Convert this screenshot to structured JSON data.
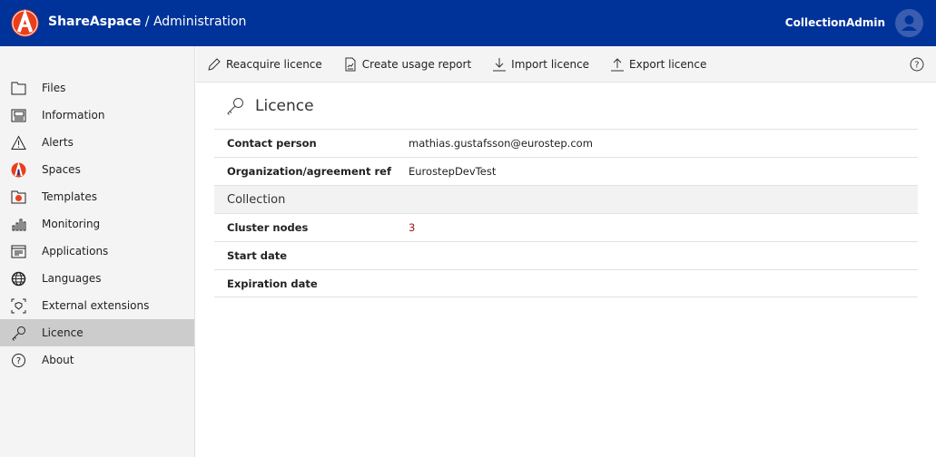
{
  "header": {
    "brand": "ShareAspace",
    "section": " / Administration",
    "user": "CollectionAdmin"
  },
  "sidebar": {
    "items": [
      {
        "label": "Files",
        "icon": "folder-icon"
      },
      {
        "label": "Information",
        "icon": "newspaper-icon"
      },
      {
        "label": "Alerts",
        "icon": "warning-icon"
      },
      {
        "label": "Spaces",
        "icon": "shareaspace-logo-icon"
      },
      {
        "label": "Templates",
        "icon": "template-folder-icon"
      },
      {
        "label": "Monitoring",
        "icon": "bar-chart-icon"
      },
      {
        "label": "Applications",
        "icon": "app-window-icon"
      },
      {
        "label": "Languages",
        "icon": "globe-icon"
      },
      {
        "label": "External extensions",
        "icon": "extension-scan-icon"
      },
      {
        "label": "Licence",
        "icon": "key-icon",
        "active": true
      },
      {
        "label": "About",
        "icon": "question-icon"
      }
    ]
  },
  "toolbar": {
    "reacquire": "Reacquire licence",
    "report": "Create usage report",
    "import": "Import licence",
    "export": "Export licence"
  },
  "page": {
    "title": "Licence",
    "contact_label": "Contact person",
    "contact_value": "mathias.gustafsson@eurostep.com",
    "org_label": "Organization/agreement ref",
    "org_value": "EurostepDevTest",
    "section": "Collection",
    "nodes_label": "Cluster nodes",
    "nodes_value": "3",
    "start_label": "Start date",
    "expiry_label": "Expiration date"
  },
  "colors": {
    "header": "#003399",
    "accent": "#e8401c",
    "value_red": "#a31515"
  }
}
